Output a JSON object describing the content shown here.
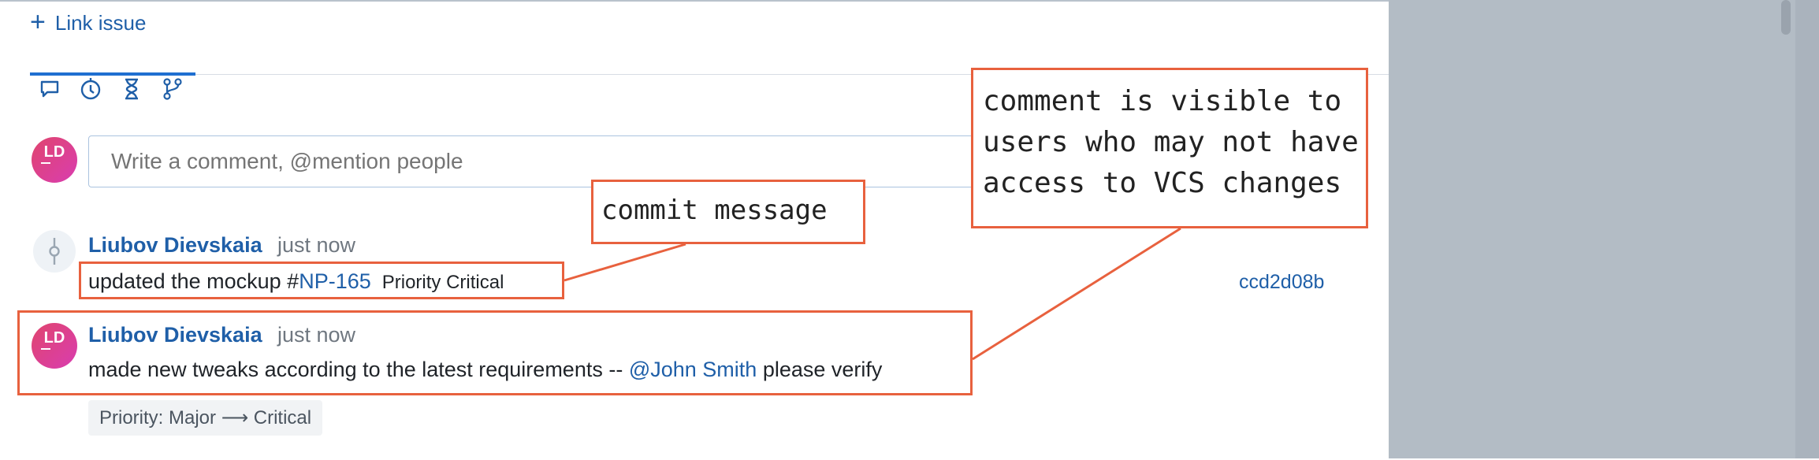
{
  "link_issue": {
    "label": "Link issue"
  },
  "tabs": [
    {
      "name": "comments"
    },
    {
      "name": "history"
    },
    {
      "name": "time-tracking"
    },
    {
      "name": "vcs"
    }
  ],
  "composer": {
    "avatar_initials": "LD",
    "placeholder": "Write a comment, @mention people"
  },
  "commit_item": {
    "author": "Liubov Dievskaia",
    "time": "just now",
    "message_prefix": "updated the mockup #",
    "issue_id": "NP-165",
    "priority_label": "Priority Critical",
    "hash": "ccd2d08b"
  },
  "comment_item": {
    "avatar_initials": "LD",
    "author": "Liubov Dievskaia",
    "time": "just now",
    "text_before": "made new tweaks according to the latest requirements -- ",
    "mention": "@John Smith",
    "text_after": " please verify",
    "change": "Priority: Major ⟶ Critical"
  },
  "annotations": {
    "commit_note": "commit message",
    "visibility_note": "comment is visible to\nusers who may not have\naccess to VCS changes"
  },
  "colors": {
    "accent": "#1f5fa8",
    "annotation": "#e8613e",
    "overlay": "#b3bcc5"
  }
}
